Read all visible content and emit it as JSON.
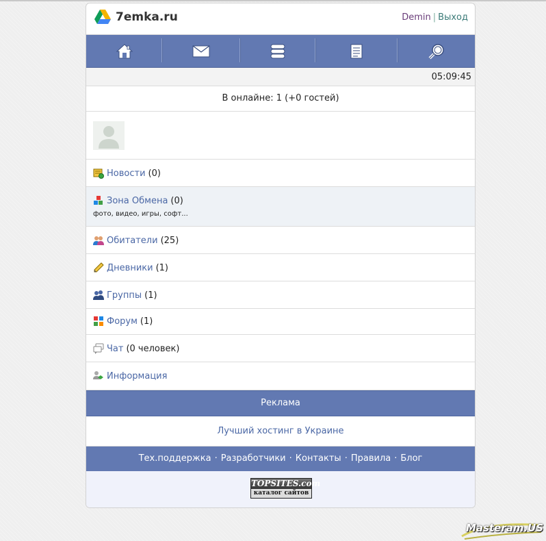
{
  "header": {
    "site_title": "7emka.ru",
    "user_name": "Demin",
    "separator": "|",
    "logout": "Выход"
  },
  "nav": {
    "items": [
      {
        "name": "home",
        "icon": "home-icon"
      },
      {
        "name": "mail",
        "icon": "mail-icon"
      },
      {
        "name": "chat",
        "icon": "chat-bubbles-icon"
      },
      {
        "name": "notes",
        "icon": "notepad-icon"
      },
      {
        "name": "search",
        "icon": "search-icon"
      }
    ]
  },
  "clock": "05:09:45",
  "online": "В онлайне: 1 (+0 гостей)",
  "menu": {
    "items": [
      {
        "label": "Новости",
        "count": "(0)",
        "icon": "news-icon"
      },
      {
        "label": "Зона Обмена",
        "count": "(0)",
        "sub": "фото, видео, игры, софт...",
        "icon": "exchange-icon"
      },
      {
        "label": "Обитатели",
        "count": "(25)",
        "icon": "users-icon"
      },
      {
        "label": "Дневники",
        "count": "(1)",
        "icon": "pencil-icon"
      },
      {
        "label": "Группы",
        "count": "(1)",
        "icon": "groups-icon"
      },
      {
        "label": "Форум",
        "count": "(1)",
        "icon": "forum-icon"
      },
      {
        "label": "Чат",
        "count": "(0 человек)",
        "icon": "chat-icon"
      },
      {
        "label": "Информация",
        "count": "",
        "icon": "info-icon"
      }
    ]
  },
  "ads": {
    "title": "Реклама",
    "link": "Лучший хостинг в Украине"
  },
  "footer": {
    "links": [
      "Тех.поддержка",
      "Разработчики",
      "Контакты",
      "Правила",
      "Блог"
    ],
    "separator": "·"
  },
  "badge": {
    "top": "TOPSITES.com",
    "bottom": "каталог сайтов"
  },
  "watermark": "Masteram.US",
  "colors": {
    "nav_bg": "#6279b2",
    "link": "#4a67a5",
    "alt_row": "#eef2f6"
  }
}
